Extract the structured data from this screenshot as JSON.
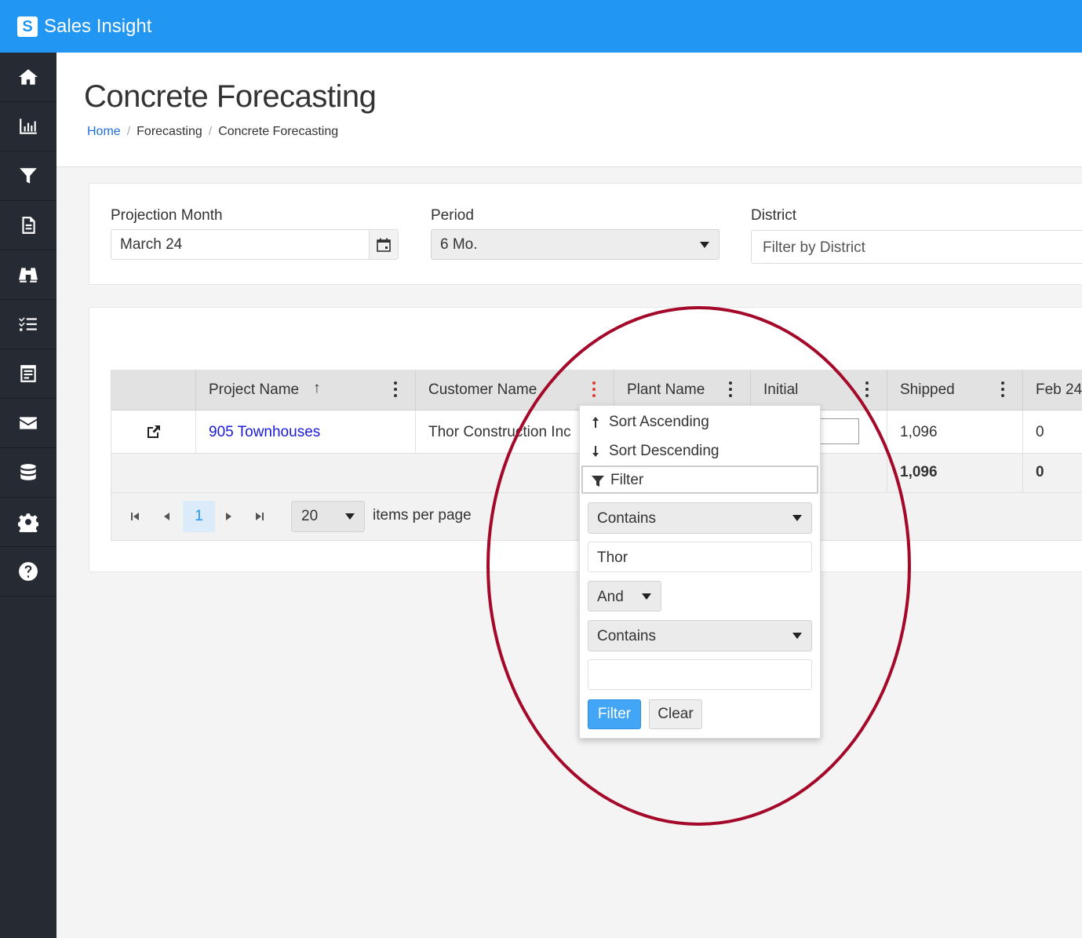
{
  "app": {
    "title": "Sales Insight",
    "logo_letter": "S"
  },
  "sidebar": {
    "items": [
      {
        "icon": "home-icon"
      },
      {
        "icon": "bar-chart-icon"
      },
      {
        "icon": "funnel-icon"
      },
      {
        "icon": "document-icon"
      },
      {
        "icon": "binoculars-icon"
      },
      {
        "icon": "checklist-icon"
      },
      {
        "icon": "report-icon"
      },
      {
        "icon": "envelope-icon"
      },
      {
        "icon": "database-icon"
      },
      {
        "icon": "gear-icon"
      },
      {
        "icon": "help-icon"
      }
    ]
  },
  "page": {
    "title": "Concrete Forecasting",
    "breadcrumb": [
      "Home",
      "Forecasting",
      "Concrete Forecasting"
    ],
    "breadcrumb_separator": "/"
  },
  "filters": {
    "projection_month": {
      "label": "Projection Month",
      "value": "March 24"
    },
    "period": {
      "label": "Period",
      "value": "6 Mo."
    },
    "district": {
      "label": "District",
      "placeholder": "Filter by District"
    }
  },
  "grid": {
    "columns": [
      "",
      "Project Name",
      "Customer Name",
      "Plant Name",
      "Initial",
      "Shipped",
      "Feb 24"
    ],
    "sort_indicator": "↑",
    "rows": [
      {
        "project_name": "905 Townhouses",
        "customer_name": "Thor Construction Inc",
        "plant_name": "",
        "initial": "",
        "shipped": "1,096",
        "feb24": "0"
      }
    ],
    "totals": {
      "shipped": "1,096",
      "feb24": "0"
    },
    "pager": {
      "current_page": "1",
      "page_size": "20",
      "items_per_page_label": "items per page"
    }
  },
  "column_menu": {
    "sort_ascending": "Sort Ascending",
    "sort_descending": "Sort Descending",
    "filter_label": "Filter",
    "operator1": "Contains",
    "value1": "Thor",
    "logic": "And",
    "operator2": "Contains",
    "value2": "",
    "filter_button": "Filter",
    "clear_button": "Clear"
  },
  "colors": {
    "brand": "#2196f3",
    "sidebar": "#252a33",
    "highlight_oval": "#a5092a",
    "active_kebab": "#e53935",
    "link": "#1a1ad8"
  }
}
